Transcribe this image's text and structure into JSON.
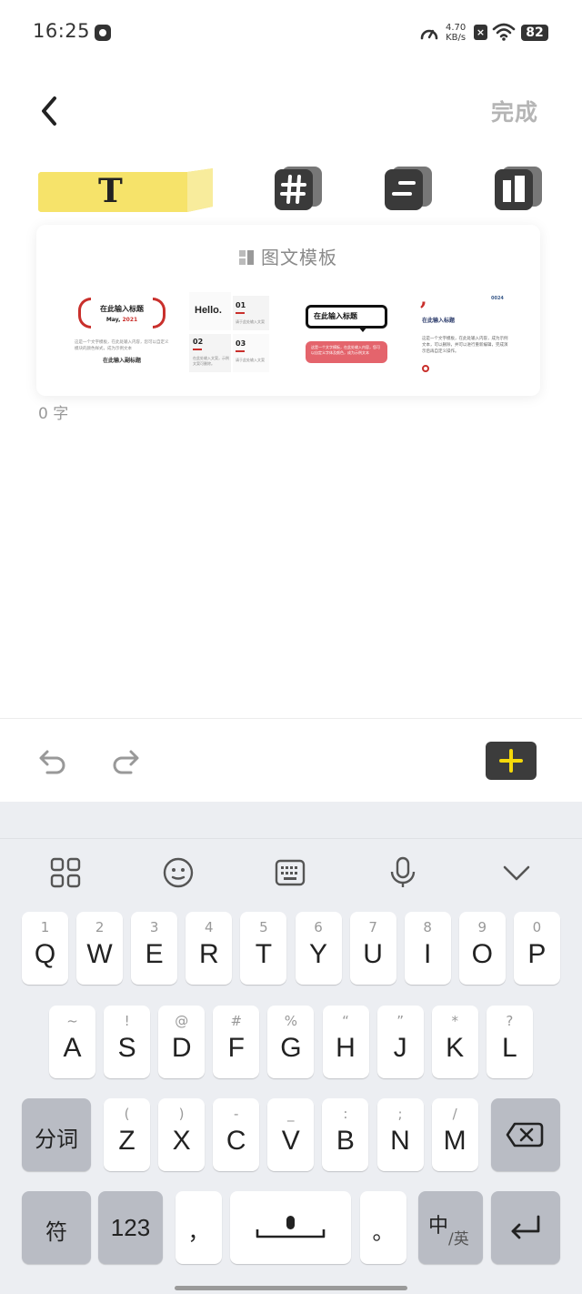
{
  "status_bar": {
    "time": "16:25",
    "network_speed_value": "4.70",
    "network_speed_unit": "KB/s",
    "battery": "82",
    "icons": [
      "app-icon",
      "speedometer-icon",
      "x-notification-icon",
      "wifi-icon",
      "battery-icon"
    ]
  },
  "header": {
    "back_icon": "chevron-left-icon",
    "done_label": "完成"
  },
  "tools": {
    "text_tool_letter": "T",
    "icons": [
      "text-style-icon",
      "hash-icon",
      "align-lines-icon",
      "panel-layout-icon"
    ]
  },
  "template_panel": {
    "title": "图文模板",
    "templates": [
      {
        "title": "在此输入标题",
        "date_prefix": "May,",
        "date_year": "2021",
        "body": "这是一个文字模板，在此处输入内容，您可以自定义模块的颜色样式，成为示例文本",
        "subtitle": "在此输入副标题"
      },
      {
        "greeting": "Hello.",
        "items": [
          {
            "num": "01",
            "text": "请于此处输入文案"
          },
          {
            "num": "02",
            "text": "在此处输入文案，示例文案可删除。"
          },
          {
            "num": "03",
            "text": "请于此处输入文案"
          }
        ]
      },
      {
        "title": "在此输入标题",
        "body": "这是一个文字模板，在此处输入内容，您可以自定义字体及颜色，成为示例文本"
      },
      {
        "quote_mark": ",",
        "page_num": "0024",
        "title": "在此输入标题",
        "body": "这是一个文字模板，在此处输入内容，成为示例文本，可以删除，并可以进行重新编辑，完成演示后再自定义操作。"
      }
    ]
  },
  "word_count": "0 字",
  "editor_toolbar": {
    "icons": [
      "undo-icon",
      "redo-icon",
      "plus-icon"
    ],
    "accent_color": "#f5d90a"
  },
  "keyboard": {
    "toolbar_icons": [
      "grid-menu-icon",
      "emoji-icon",
      "keyboard-icon",
      "microphone-icon",
      "collapse-chevron-icon"
    ],
    "row1": [
      {
        "hint": "1",
        "key": "Q"
      },
      {
        "hint": "2",
        "key": "W"
      },
      {
        "hint": "3",
        "key": "E"
      },
      {
        "hint": "4",
        "key": "R"
      },
      {
        "hint": "5",
        "key": "T"
      },
      {
        "hint": "6",
        "key": "Y"
      },
      {
        "hint": "7",
        "key": "U"
      },
      {
        "hint": "8",
        "key": "I"
      },
      {
        "hint": "9",
        "key": "O"
      },
      {
        "hint": "0",
        "key": "P"
      }
    ],
    "row2": [
      {
        "hint": "~",
        "key": "A"
      },
      {
        "hint": "!",
        "key": "S"
      },
      {
        "hint": "@",
        "key": "D"
      },
      {
        "hint": "#",
        "key": "F"
      },
      {
        "hint": "%",
        "key": "G"
      },
      {
        "hint": "“",
        "key": "H"
      },
      {
        "hint": "”",
        "key": "J"
      },
      {
        "hint": "*",
        "key": "K"
      },
      {
        "hint": "?",
        "key": "L"
      }
    ],
    "row3": [
      {
        "hint": "(",
        "key": "Z"
      },
      {
        "hint": ")",
        "key": "X"
      },
      {
        "hint": "-",
        "key": "C"
      },
      {
        "hint": "_",
        "key": "V"
      },
      {
        "hint": ":",
        "key": "B"
      },
      {
        "hint": ";",
        "key": "N"
      },
      {
        "hint": "/",
        "key": "M"
      }
    ],
    "segment_label": "分词",
    "symbols_label": "符",
    "numbers_label": "123",
    "comma": "，",
    "period": "。",
    "lang_main": "中",
    "lang_sub": "/英"
  }
}
